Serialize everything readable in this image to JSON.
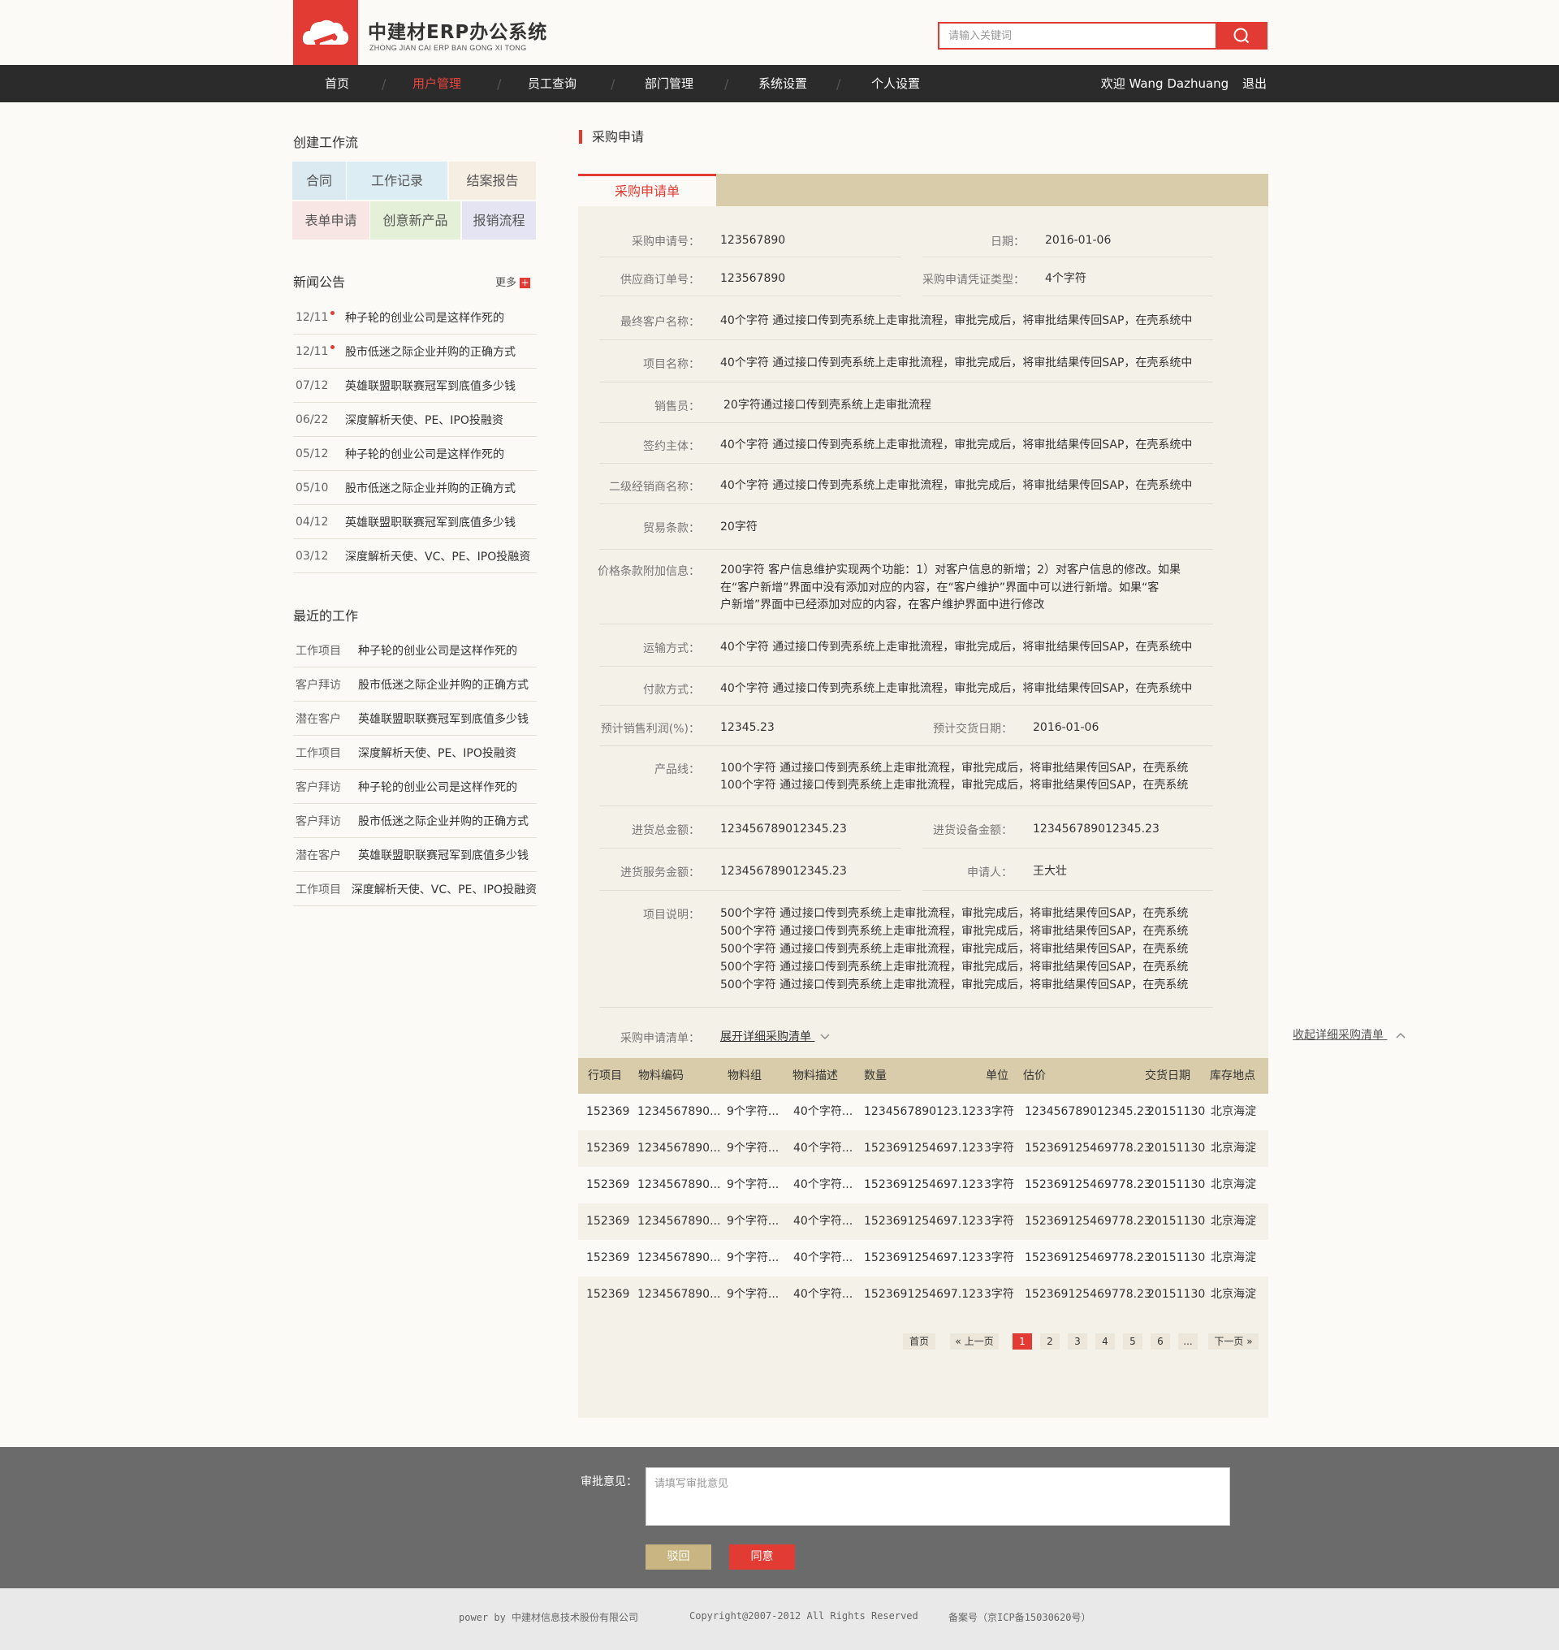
{
  "header": {
    "logo_title": "中建材ERP办公系统",
    "logo_subtitle": "ZHONG JIAN CAI ERP BAN GONG XI TONG",
    "search_placeholder": "请输入关键词"
  },
  "nav": {
    "items": [
      {
        "label": "首页",
        "active": false
      },
      {
        "label": "用户管理",
        "active": true
      },
      {
        "label": "员工查询",
        "active": false
      },
      {
        "label": "部门管理",
        "active": false
      },
      {
        "label": "系统设置",
        "active": false
      },
      {
        "label": "个人设置",
        "active": false
      }
    ],
    "separator": "/",
    "welcome": "欢迎 Wang Dazhuang",
    "logout": "退出"
  },
  "sidebar": {
    "create_title": "创建工作流",
    "tiles": [
      {
        "label": "合同",
        "bg": "#dbe9f1",
        "color": "#555"
      },
      {
        "label": "工作记录",
        "bg": "#dcedf4",
        "color": "#555"
      },
      {
        "label": "结案报告",
        "bg": "#f6ede3",
        "color": "#555"
      },
      {
        "label": "表单申请",
        "bg": "#f7e6e3",
        "color": "#555"
      },
      {
        "label": "创意新产品",
        "bg": "#e5f0d8",
        "color": "#555"
      },
      {
        "label": "报销流程",
        "bg": "#e4e4f2",
        "color": "#555"
      }
    ],
    "news_title": "新闻公告",
    "news_more": "更多",
    "news": [
      {
        "date": "12/11",
        "title": "种子轮的创业公司是这样作死的",
        "new": true
      },
      {
        "date": "12/11",
        "title": "股市低迷之际企业并购的正确方式",
        "new": true
      },
      {
        "date": "07/12",
        "title": "英雄联盟职联赛冠军到底值多少钱",
        "new": false
      },
      {
        "date": "06/22",
        "title": "深度解析天使、PE、IPO投融资",
        "new": false
      },
      {
        "date": "05/12",
        "title": "种子轮的创业公司是这样作死的",
        "new": false
      },
      {
        "date": "05/10",
        "title": "股市低迷之际企业并购的正确方式",
        "new": false
      },
      {
        "date": "04/12",
        "title": "英雄联盟职联赛冠军到底值多少钱",
        "new": false
      },
      {
        "date": "03/12",
        "title": "深度解析天使、VC、PE、IPO投融资",
        "new": false
      }
    ],
    "recent_title": "最近的工作",
    "recent": [
      {
        "kind": "工作项目",
        "title": "种子轮的创业公司是这样作死的"
      },
      {
        "kind": "客户拜访",
        "title": "股市低迷之际企业并购的正确方式"
      },
      {
        "kind": "潜在客户",
        "title": "英雄联盟职联赛冠军到底值多少钱"
      },
      {
        "kind": "工作项目",
        "title": "深度解析天使、PE、IPO投融资"
      },
      {
        "kind": "客户拜访",
        "title": "种子轮的创业公司是这样作死的"
      },
      {
        "kind": "客户拜访",
        "title": "股市低迷之际企业并购的正确方式"
      },
      {
        "kind": "潜在客户",
        "title": "英雄联盟职联赛冠军到底值多少钱"
      },
      {
        "kind": "工作项目",
        "title": "深度解析天使、VC、PE、IPO投融资"
      }
    ]
  },
  "main": {
    "title": "采购申请",
    "tab": "采购申请单",
    "fields": {
      "req_no_label": "采购申请号：",
      "req_no": "123567890",
      "date_label": "日期：",
      "date": "2016-01-06",
      "supplier_order_label": "供应商订单号：",
      "supplier_order": "123567890",
      "voucher_type_label": "采购申请凭证类型：",
      "voucher_type": "4个字符",
      "end_customer_label": "最终客户名称：",
      "end_customer": "40个字符  通过接口传到壳系统上走审批流程，审批完成后，将审批结果传回SAP，在壳系统中",
      "project_name_label": "项目名称：",
      "project_name": "40个字符  通过接口传到壳系统上走审批流程，审批完成后，将审批结果传回SAP，在壳系统中",
      "sales_label": "销售员：",
      "sales": "20字符通过接口传到壳系统上走审批流程",
      "signing_label": "签约主体：",
      "signing": "40个字符  通过接口传到壳系统上走审批流程，审批完成后，将审批结果传回SAP，在壳系统中",
      "dealer_label": "二级经销商名称：",
      "dealer": "40个字符  通过接口传到壳系统上走审批流程，审批完成后，将审批结果传回SAP，在壳系统中",
      "trade_label": "贸易条款：",
      "trade": "20字符",
      "price_label": "价格条款附加信息：",
      "price_lines": [
        "200字符  客户信息维护实现两个功能：1）对客户信息的新增；2）对客户信息的修改。如果",
        "在“客户新增”界面中没有添加对应的内容，在“客户维护”界面中可以进行新增。如果“客",
        "户新增”界面中已经添加对应的内容，在客户维护界面中进行修改"
      ],
      "transport_label": "运输方式：",
      "transport": "40个字符  通过接口传到壳系统上走审批流程，审批完成后，将审批结果传回SAP，在壳系统中",
      "payment_label": "付款方式：",
      "payment": "40个字符  通过接口传到壳系统上走审批流程，审批完成后，将审批结果传回SAP，在壳系统中",
      "profit_label": "预计销售利润(%)：",
      "profit": "12345.23",
      "delivery_label": "预计交货日期：",
      "delivery": "2016-01-06",
      "product_line_label": "产品线：",
      "product_lines": [
        "100个字符  通过接口传到壳系统上走审批流程，审批完成后，将审批结果传回SAP，在壳系统",
        "100个字符  通过接口传到壳系统上走审批流程，审批完成后，将审批结果传回SAP，在壳系统"
      ],
      "total_label": "进货总金额：",
      "total": "123456789012345.23",
      "equip_label": "进货设备金额：",
      "equip": "123456789012345.23",
      "service_label": "进货服务金额：",
      "service": "123456789012345.23",
      "applicant_label": "申请人：",
      "applicant": "王大壮",
      "desc_label": "项目说明：",
      "desc_lines": [
        "500个字符  通过接口传到壳系统上走审批流程，审批完成后，将审批结果传回SAP，在壳系统",
        "500个字符  通过接口传到壳系统上走审批流程，审批完成后，将审批结果传回SAP，在壳系统",
        "500个字符  通过接口传到壳系统上走审批流程，审批完成后，将审批结果传回SAP，在壳系统",
        "500个字符  通过接口传到壳系统上走审批流程，审批完成后，将审批结果传回SAP，在壳系统",
        "500个字符  通过接口传到壳系统上走审批流程，审批完成后，将审批结果传回SAP，在壳系统"
      ],
      "list_label": "采购申请清单：",
      "expand": "展开详细采购清单"
    },
    "collapse": "收起详细采购清单",
    "table": {
      "headers": [
        "行项目",
        "物料编码",
        "物料组",
        "物料描述",
        "数量",
        "单位",
        "估价",
        "交货日期",
        "库存地点"
      ],
      "rows": [
        [
          "152369",
          "1234567890...",
          "9个字符...",
          "40个字符...",
          "1234567890123.123",
          "3字符",
          "1234567890123​45.23",
          "20151130",
          "北京海淀"
        ],
        [
          "152369",
          "1234567890...",
          "9个字符...",
          "40个字符...",
          "1523691254697.123",
          "3字符",
          "152369125469778.23",
          "20151130",
          "北京海淀"
        ],
        [
          "152369",
          "1234567890...",
          "9个字符...",
          "40个字符...",
          "1523691254697.123",
          "3字符",
          "152369125469778.23",
          "20151130",
          "北京海淀"
        ],
        [
          "152369",
          "1234567890...",
          "9个字符...",
          "40个字符...",
          "1523691254697.123",
          "3字符",
          "152369125469778.23",
          "20151130",
          "北京海淀"
        ],
        [
          "152369",
          "1234567890...",
          "9个字符...",
          "40个字符...",
          "1523691254697.123",
          "3字符",
          "152369125469778.23",
          "20151130",
          "北京海淀"
        ],
        [
          "152369",
          "1234567890...",
          "9个字符...",
          "40个字符...",
          "1523691254697.123",
          "3字符",
          "152369125469778.23",
          "20151130",
          "北京海淀"
        ]
      ]
    },
    "pager": {
      "first": "首页",
      "prev": "« 上一页",
      "pages": [
        "1",
        "2",
        "3",
        "4",
        "5",
        "6",
        "..."
      ],
      "current": "1",
      "next": "下一页 »"
    }
  },
  "review": {
    "label": "审批意见：",
    "placeholder": "请填写审批意见",
    "reject": "驳回",
    "agree": "同意",
    "reject_color": "#c8b582",
    "agree_color": "#e23b34"
  },
  "footer": {
    "power": "power by 中建材信息技术股份有限公司",
    "copyright": "Copyright@2007-2012 All Rights Reserved",
    "icp": "备案号（京ICP备15030620号）"
  },
  "colors": {
    "accent": "#e23b34",
    "nav_bg": "#2b2b2b",
    "tab_bar": "#d9ccaa",
    "panel": "#f4f1e9"
  }
}
